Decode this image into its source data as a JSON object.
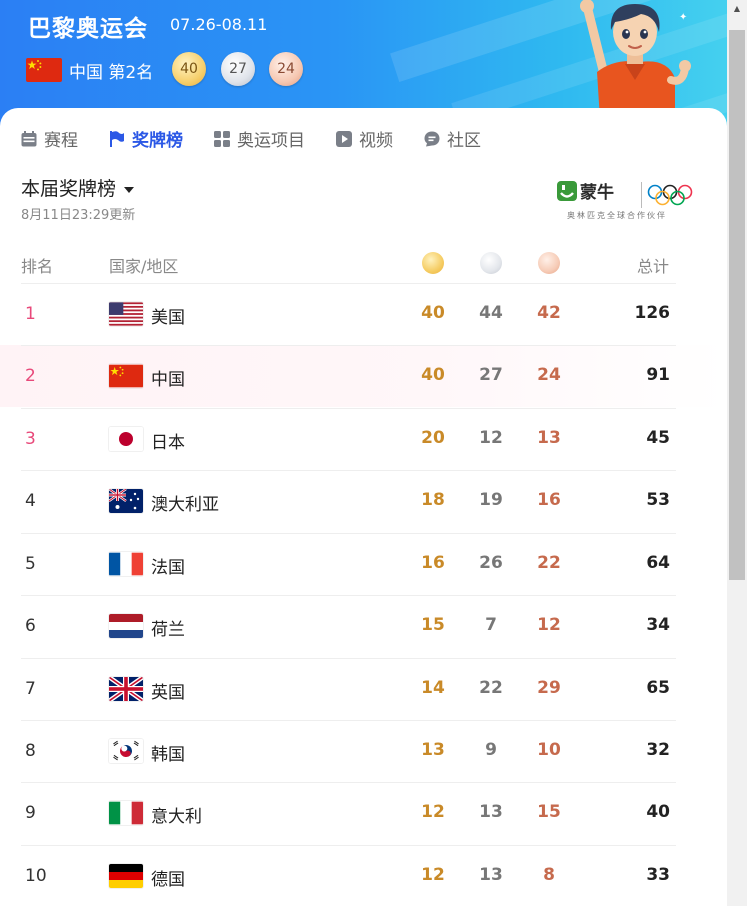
{
  "header": {
    "title": "巴黎奥运会",
    "dates": "07.26-08.11",
    "country_rank": "中国 第2名",
    "medals": {
      "gold": "40",
      "silver": "27",
      "bronze": "24"
    }
  },
  "tabs": [
    {
      "label": "赛程",
      "icon": "calendar-icon"
    },
    {
      "label": "奖牌榜",
      "icon": "flag-icon",
      "active": true
    },
    {
      "label": "奥运项目",
      "icon": "grid-icon"
    },
    {
      "label": "视频",
      "icon": "play-icon"
    },
    {
      "label": "社区",
      "icon": "chat-icon"
    }
  ],
  "board": {
    "title": "本届奖牌榜",
    "updated": "8月11日23:29更新",
    "sponsor_name": "蒙牛",
    "sponsor_caption": "奥林匹克全球合作伙伴"
  },
  "table": {
    "headers": {
      "rank": "排名",
      "country": "国家/地区",
      "total": "总计"
    },
    "rows": [
      {
        "rank": "1",
        "country": "美国",
        "gold": "40",
        "silver": "44",
        "bronze": "42",
        "total": "126"
      },
      {
        "rank": "2",
        "country": "中国",
        "gold": "40",
        "silver": "27",
        "bronze": "24",
        "total": "91"
      },
      {
        "rank": "3",
        "country": "日本",
        "gold": "20",
        "silver": "12",
        "bronze": "13",
        "total": "45"
      },
      {
        "rank": "4",
        "country": "澳大利亚",
        "gold": "18",
        "silver": "19",
        "bronze": "16",
        "total": "53"
      },
      {
        "rank": "5",
        "country": "法国",
        "gold": "16",
        "silver": "26",
        "bronze": "22",
        "total": "64"
      },
      {
        "rank": "6",
        "country": "荷兰",
        "gold": "15",
        "silver": "7",
        "bronze": "12",
        "total": "34"
      },
      {
        "rank": "7",
        "country": "英国",
        "gold": "14",
        "silver": "22",
        "bronze": "29",
        "total": "65"
      },
      {
        "rank": "8",
        "country": "韩国",
        "gold": "13",
        "silver": "9",
        "bronze": "10",
        "total": "32"
      },
      {
        "rank": "9",
        "country": "意大利",
        "gold": "12",
        "silver": "13",
        "bronze": "15",
        "total": "40"
      },
      {
        "rank": "10",
        "country": "德国",
        "gold": "12",
        "silver": "13",
        "bronze": "8",
        "total": "33"
      }
    ]
  },
  "colors": {
    "accent": "#2b58e6",
    "rank_top": "#e8497a",
    "gold": "#c98a28",
    "silver": "#777777",
    "bronze": "#c66a4d"
  }
}
